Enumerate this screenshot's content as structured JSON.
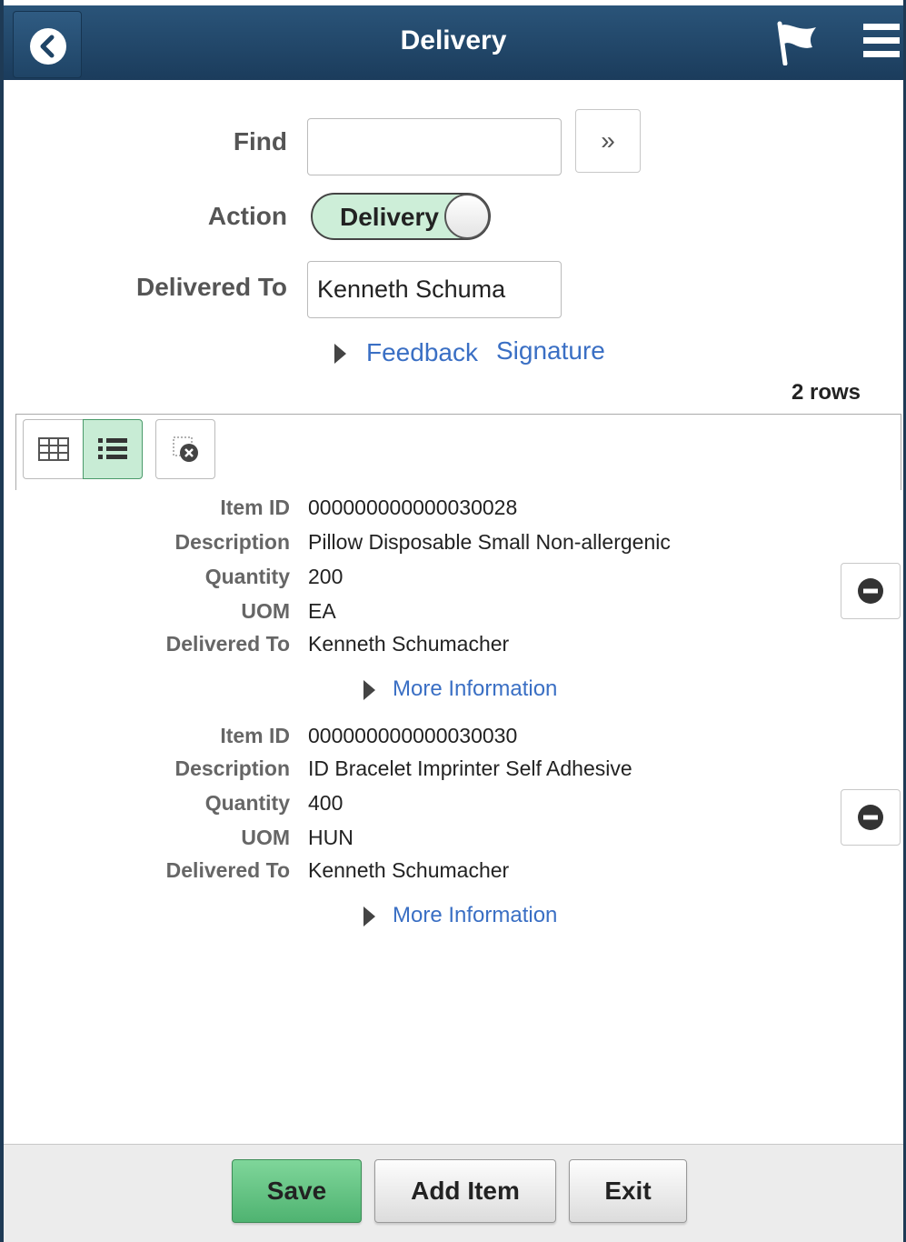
{
  "header": {
    "title": "Delivery",
    "back_icon": "chevron-left-icon",
    "flag_icon": "flag-icon",
    "menu_icon": "hamburger-menu-icon",
    "accent_color": "#1f4466"
  },
  "form": {
    "find_label": "Find",
    "find_value": "",
    "go_label": "»",
    "action_label": "Action",
    "action_toggle_label": "Delivery",
    "action_toggle_color": "#cdeed8",
    "delivered_to_label": "Delivered To",
    "delivered_to_value": "Kenneth Schuma",
    "feedback_link": "Feedback",
    "signature_link": "Signature"
  },
  "grid": {
    "rows_count": "2 rows",
    "grid_view_icon": "grid-view-icon",
    "list_view_icon": "list-view-icon",
    "clear_icon": "clear-filter-icon"
  },
  "field_labels": {
    "item_id": "Item ID",
    "description": "Description",
    "quantity": "Quantity",
    "uom": "UOM",
    "delivered_to": "Delivered To",
    "more_info": "More Information"
  },
  "items": [
    {
      "item_id": "000000000000030028",
      "description": "Pillow Disposable Small  Non-allergenic",
      "quantity": "200",
      "uom": "EA",
      "delivered_to": "Kenneth Schumacher"
    },
    {
      "item_id": "000000000000030030",
      "description": "ID Bracelet Imprinter Self Adhesive",
      "quantity": "400",
      "uom": "HUN",
      "delivered_to": "Kenneth Schumacher"
    }
  ],
  "footer": {
    "save_label": "Save",
    "add_item_label": "Add Item",
    "exit_label": "Exit",
    "save_color": "#5fbf7f"
  }
}
